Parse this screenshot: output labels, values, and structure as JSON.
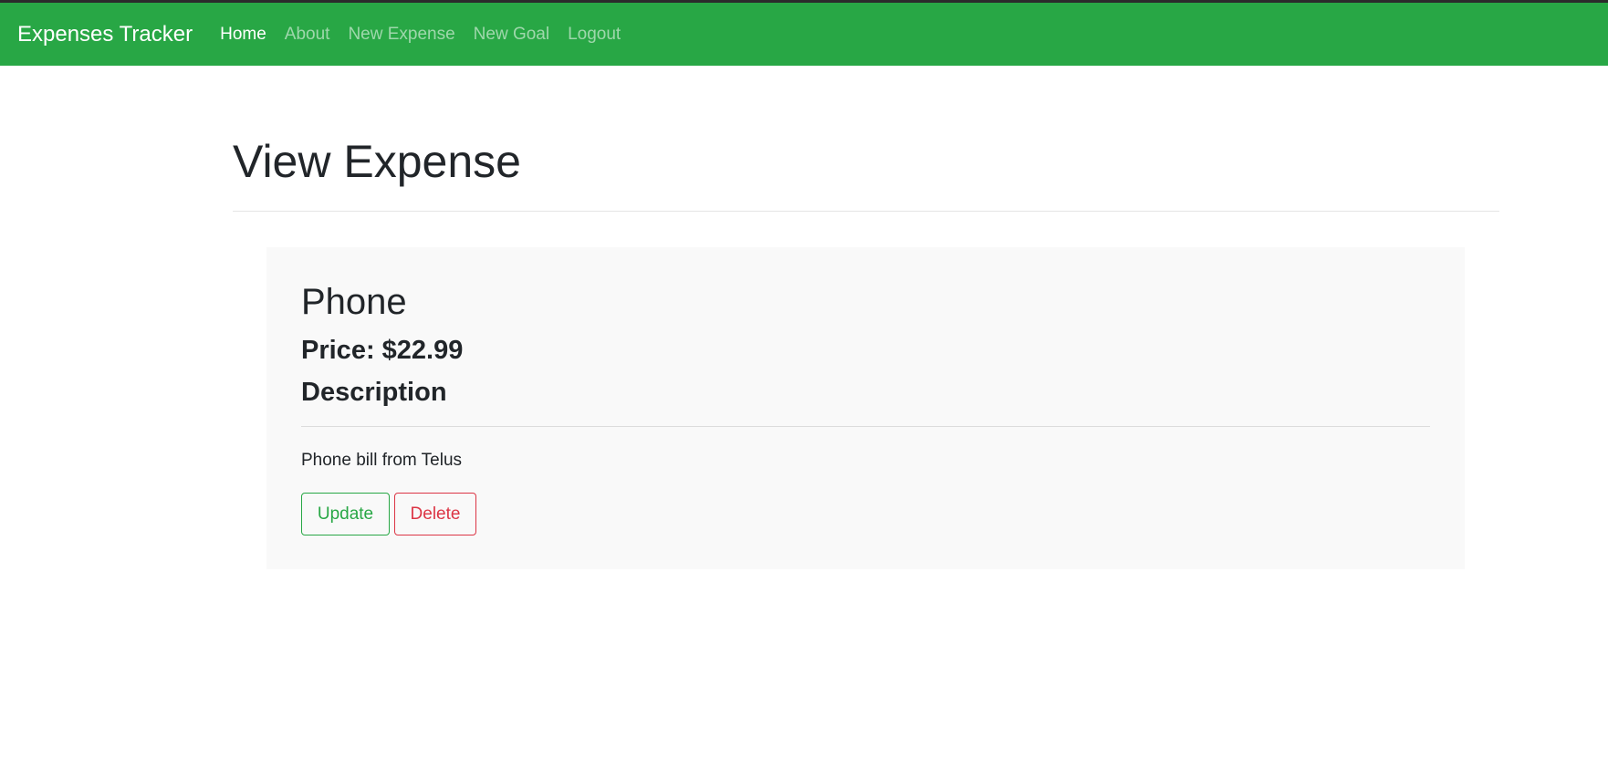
{
  "navbar": {
    "brand": "Expenses Tracker",
    "items": [
      {
        "label": "Home",
        "active": true
      },
      {
        "label": "About",
        "active": false
      },
      {
        "label": "New Expense",
        "active": false
      },
      {
        "label": "New Goal",
        "active": false
      },
      {
        "label": "Logout",
        "active": false
      }
    ]
  },
  "page": {
    "title": "View Expense"
  },
  "expense": {
    "name": "Phone",
    "price": "Price: $22.99",
    "description_heading": "Description",
    "description": "Phone bill from Telus",
    "update_label": "Update",
    "delete_label": "Delete"
  },
  "colors": {
    "navbar_bg": "#28a745",
    "card_bg": "#f9f9f9",
    "update": "#28a745",
    "delete": "#dc3545"
  }
}
